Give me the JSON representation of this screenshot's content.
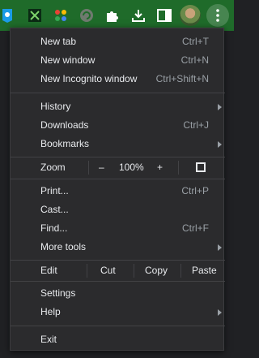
{
  "menu": {
    "new_tab": {
      "label": "New tab",
      "shortcut": "Ctrl+T"
    },
    "new_window": {
      "label": "New window",
      "shortcut": "Ctrl+N"
    },
    "new_incognito": {
      "label": "New Incognito window",
      "shortcut": "Ctrl+Shift+N"
    },
    "history": {
      "label": "History"
    },
    "downloads": {
      "label": "Downloads",
      "shortcut": "Ctrl+J"
    },
    "bookmarks": {
      "label": "Bookmarks"
    },
    "zoom": {
      "label": "Zoom",
      "minus": "–",
      "level": "100%",
      "plus": "+"
    },
    "print": {
      "label": "Print...",
      "shortcut": "Ctrl+P"
    },
    "cast": {
      "label": "Cast..."
    },
    "find": {
      "label": "Find...",
      "shortcut": "Ctrl+F"
    },
    "more_tools": {
      "label": "More tools"
    },
    "edit": {
      "label": "Edit",
      "cut": "Cut",
      "copy": "Copy",
      "paste": "Paste"
    },
    "settings": {
      "label": "Settings"
    },
    "help": {
      "label": "Help"
    },
    "exit": {
      "label": "Exit"
    }
  },
  "colors": {
    "toolbar_bg": "#1f6b2a",
    "menu_bg": "#2b2b2d",
    "text": "#e8eaed",
    "shortcut_text": "#9aa0a6"
  }
}
